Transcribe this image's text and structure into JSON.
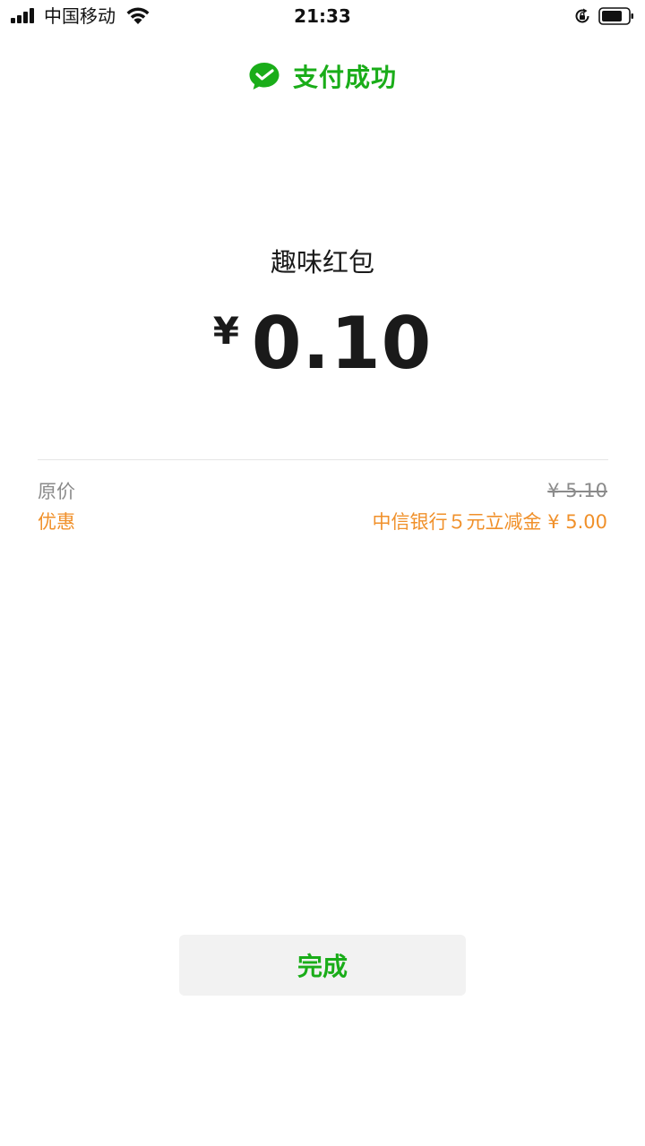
{
  "status_bar": {
    "carrier": "中国移动",
    "time": "21:33"
  },
  "header": {
    "title": "支付成功",
    "icon": "wechat-pay-icon"
  },
  "payment": {
    "merchant": "趣味红包",
    "currency_symbol": "¥",
    "amount": "0.10"
  },
  "details": {
    "original_label": "原价",
    "original_value": "¥ 5.10",
    "discount_label": "优惠",
    "discount_value": "中信银行５元立减金 ¥ 5.00"
  },
  "done_button": {
    "label": "完成"
  },
  "colors": {
    "brand_green": "#1aad19",
    "discount_orange": "#f0902a",
    "muted_gray": "#8a8a8a"
  }
}
